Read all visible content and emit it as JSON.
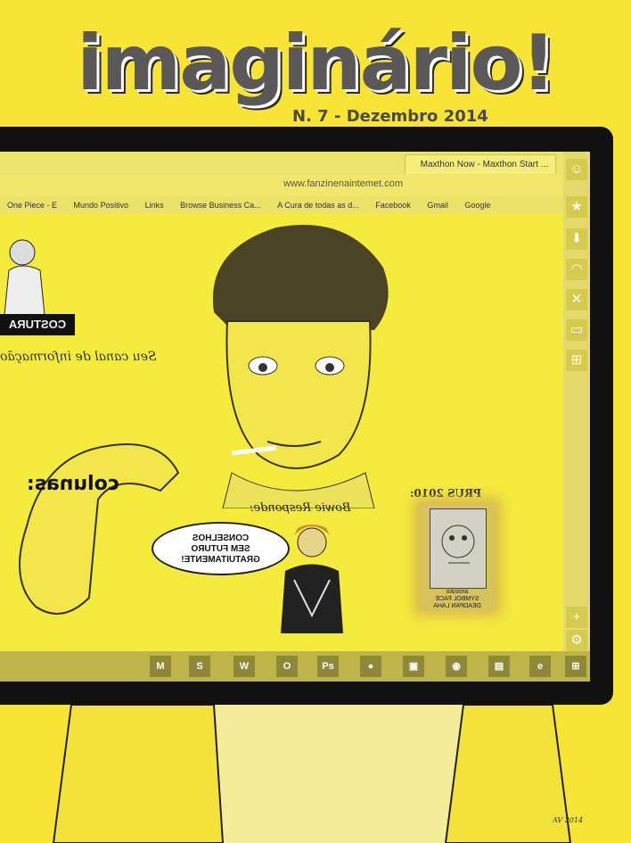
{
  "cover": {
    "title": "imaginário!",
    "issue": "N. 7 - Dezembro 2014"
  },
  "browser": {
    "tab_title": "Maxthon Now - Maxthon Start ...",
    "url": "www.fanzinenaintemet.com",
    "bookmarks": [
      "Google",
      "Gmail",
      "Facebook",
      "A Cura de todas as d...",
      "Browse Business Ca...",
      "Links",
      "Mundo Positivo",
      "One Piece - E"
    ]
  },
  "page": {
    "colunas": "colunas:",
    "bowie_header": "Bowie Responde:",
    "bubble": [
      "CONSELHOS",
      "SEM FUTURO",
      "GRATUITAMENTE!"
    ],
    "prus": "PRUS 2010:",
    "poster_caption": [
      "SYMBOL FACE",
      "DEADPAN LAHA",
      "aroosko"
    ],
    "canal": "Seu canal de informação",
    "costura": "COSTURA"
  },
  "sidebar_icons": [
    "smiley-icon",
    "star-icon",
    "download-icon",
    "rss-icon",
    "tools-icon",
    "window-icon",
    "gamepad-icon"
  ],
  "taskbar": [
    "M",
    "S",
    "W",
    "O",
    "Ps",
    "",
    "",
    "",
    "",
    "e",
    ""
  ],
  "signature": "AV 2014"
}
